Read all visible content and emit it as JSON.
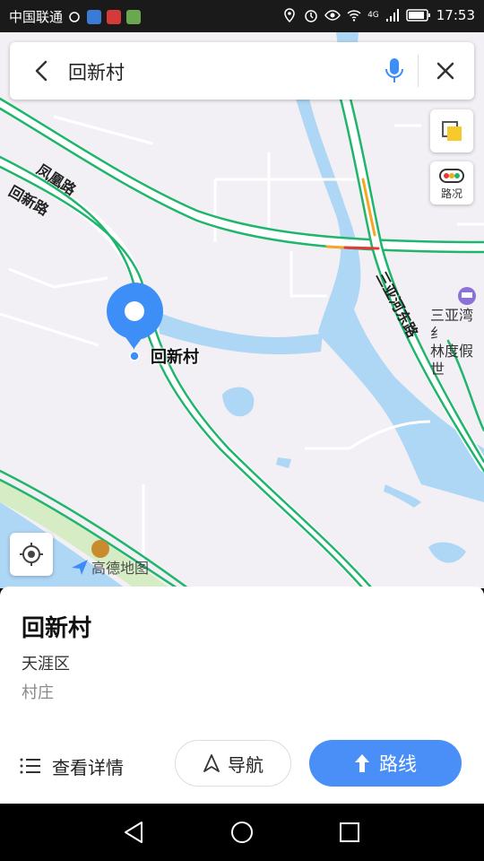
{
  "status_bar": {
    "carrier": "中国联通",
    "time": "17:53",
    "network": "4G"
  },
  "search": {
    "query": "回新村"
  },
  "map": {
    "roads": [
      "凤凰路",
      "回新路",
      "三亚河东路"
    ],
    "poi_marker_label": "回新村",
    "nearby_poi": "三亚湾红林度假世",
    "nearby_poi_line1": "三亚湾纟",
    "nearby_poi_line2": "林度假世",
    "watermark": "高德地图",
    "traffic_label": "路况",
    "colors": {
      "land": "#f2f0f4",
      "water": "#aed6f5",
      "road_green": "#1fb56c",
      "road_red": "#e53935",
      "road_orange": "#f5a623",
      "marker": "#3e8ef7"
    }
  },
  "place": {
    "name": "回新村",
    "district": "天涯区",
    "type": "村庄"
  },
  "actions": {
    "details": "查看详情",
    "navigate": "导航",
    "route": "路线"
  }
}
